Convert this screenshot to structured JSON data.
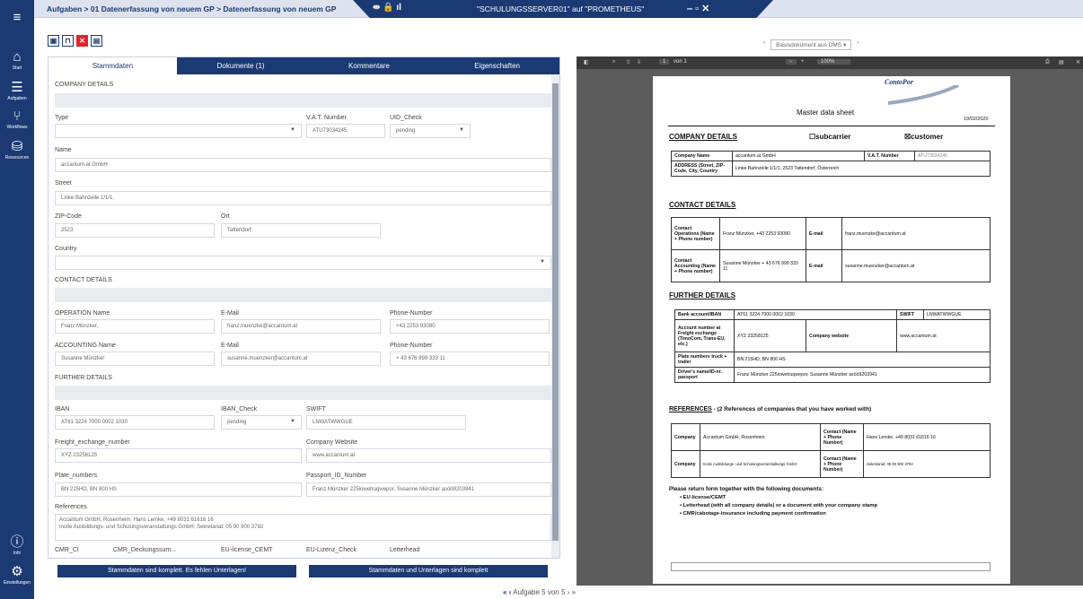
{
  "rail": {
    "items": [
      {
        "label": "Start"
      },
      {
        "label": "Aufgaben"
      },
      {
        "label": "Workflows"
      },
      {
        "label": "Ressourcen"
      },
      {
        "label": "Info"
      },
      {
        "label": "Einstellungen"
      }
    ]
  },
  "topbar": {
    "breadcrumb": "Aufgaben > 01 Datenerfassung von neuem GP > Datenerfassung von neuem GP",
    "server": "\"SCHULUNGSSERVER01\" auf \"PROMETHEUS\""
  },
  "tabs": [
    "Stammdaten",
    "Dokumente (1)",
    "Kommentare",
    "Eigenschaften"
  ],
  "form": {
    "company_details": "COMPANY DETAILS",
    "type_label": "Type",
    "vat_label": "V.A.T. Number",
    "vat_value": "ATU73034245",
    "uid_label": "UID_Check",
    "uid_value": "pending",
    "name_label": "Name",
    "name_value": "accantum.at GmbH",
    "street_label": "Street",
    "street_value": "Linke Bahnzeile 1/1/1,",
    "zip_label": "ZIP-Code",
    "zip_value": "2523",
    "ort_label": "Ort",
    "ort_value": "Tattendorf",
    "country_label": "Country",
    "contact_details": "CONTACT DETAILS",
    "op_name_label": "OPERATION Name",
    "op_name_value": "Franz Münzker,",
    "op_email_label": "E-Mail",
    "op_email_value": "franz.muenzke@accantum.at",
    "op_phone_label": "Phone-Number",
    "op_phone_value": "+43 2253 93080",
    "acc_name_label": "ACCOUNTING Name",
    "acc_name_value": "Susanne Münzker",
    "acc_email_label": "E-Mail",
    "acc_email_value": "susanne.muenzker@accantum.at",
    "acc_phone_label": "Phone-Number",
    "acc_phone_value": "+ 43 676 999 333 11",
    "further_details": "FURTHER DETAILS",
    "iban_label": "IBAN",
    "iban_value": "AT61 3224 7000 0002 1030",
    "ibancheck_label": "IBAN_Check",
    "ibancheck_value": "pending",
    "swift_label": "SWIFT",
    "swift_value": "LNWATWWGUE",
    "freight_label": "Freight_exchange_number",
    "freight_value": "XYZ 23258125",
    "web_label": "Company Website",
    "web_value": "www.accantum.at",
    "plate_label": "Plate_numbers",
    "plate_value": "BN 215HD, BN 800 HS",
    "pass_label": "Passport_ID_Number",
    "pass_value": "Franz Münzker 225iowetruqwepor, Susanne Münzker asöö9203941",
    "refs_label": "References",
    "refs_line1": "Accantum GmbH, Rosenheim; Hans Lemke, +49 8031 61616 16",
    "refs_line2": "Incite Ausbildungs- und Schulungsveranstaltungs GmbH; Sekretariat: 05 90 900 3792",
    "cmr_label": "CMR_CI",
    "cmrdeck_label": "CMR_Deckungssum...",
    "eulic_label": "EU-license_CEMT",
    "eulizcheck_label": "EU-Lizenz_Check",
    "letterhead_label": "Letterhead",
    "btn_incomplete": "Stammdaten sind komplett. Es fehlen Unterlagen!",
    "btn_complete": "Stammdaten und Unterlagen sind komplett"
  },
  "dms": {
    "label": "Basisdokument aus DMS"
  },
  "pdftoolbar": {
    "page": "1",
    "of": "von 1",
    "zoom": "100%"
  },
  "doc": {
    "logo": "ContoPor",
    "title": "Master data sheet",
    "date": "19/02/2020",
    "company_details": "COMPANY DETAILS",
    "subcarrier": "subcarrier",
    "customer": "customer",
    "company_name_lbl": "Company Name",
    "company_name": "accantum.at GmbH",
    "vat_lbl": "V.A.T. Number",
    "vat": "ATU73034245",
    "address_lbl": "ADDRESS (Street, ZIP-Code, City, Country",
    "address": "Linke Bahnzeile 1/1/1, 2523 Tattendorf, Österreich",
    "contact_details": "CONTACT DETAILS",
    "op_lbl": "Contact Operations (Name + Phone number)",
    "op_val": "Franz Münzker, +43 2253 93080",
    "email_lbl": "E-mail",
    "op_email": "franz.muenzke@accantum.at",
    "acc_lbl": "Contact Accounting (Name + Phone number)",
    "acc_val": "Susanne Münzker + 43 676 999 333 11",
    "acc_email": "susanne.muenzker@accantum.at",
    "further": "FURTHER DETAILS",
    "bank_lbl": "Bank account/IBAN",
    "bank": "AT61 3224 7000 0002 1030",
    "swift_lbl": "SWIFT",
    "swift": "LNWATWWGUE",
    "fx_lbl": "Account number at Freight exchange (TimoCom, Trans-EU, etc.)",
    "fx": "XYZ 23258125",
    "web_lbl": "Company website",
    "web": "www.accantum.at",
    "plate_lbl": "Plate numbers truck + trailer",
    "plate": "BN 215HD, BN 800 HS",
    "driver_lbl": "Driver's name/ID-nr. passport",
    "driver": "Franz Münzker 225iowetruqwepor, Susanne Münzker asöö9203941",
    "refs_h": "REFERENCES",
    "refs_note": "- (2 References of companies that you have worked with)",
    "company_lbl": "Company",
    "ref1": "Accantum GmbH, Rosenheim",
    "contact_lbl": "Contact (Name + Phone Number)",
    "ref1c": "Hans Lemke, +49 8031 61616 16",
    "ref2": "Incite Ausbildungs- und Schulungsveranstaltungs GmbH",
    "ref2c": "Sekretariat: 05 90 900 3792",
    "return": "Please return form together with the following documents:",
    "b1": "EU-license/CEMT",
    "b2": "Letterhead (with all company details) or a document with your company stamp",
    "b3": "CMR/cabotage-insurance including payment confirmation"
  },
  "pagination": {
    "text": "Aufgabe 5 von 5"
  }
}
